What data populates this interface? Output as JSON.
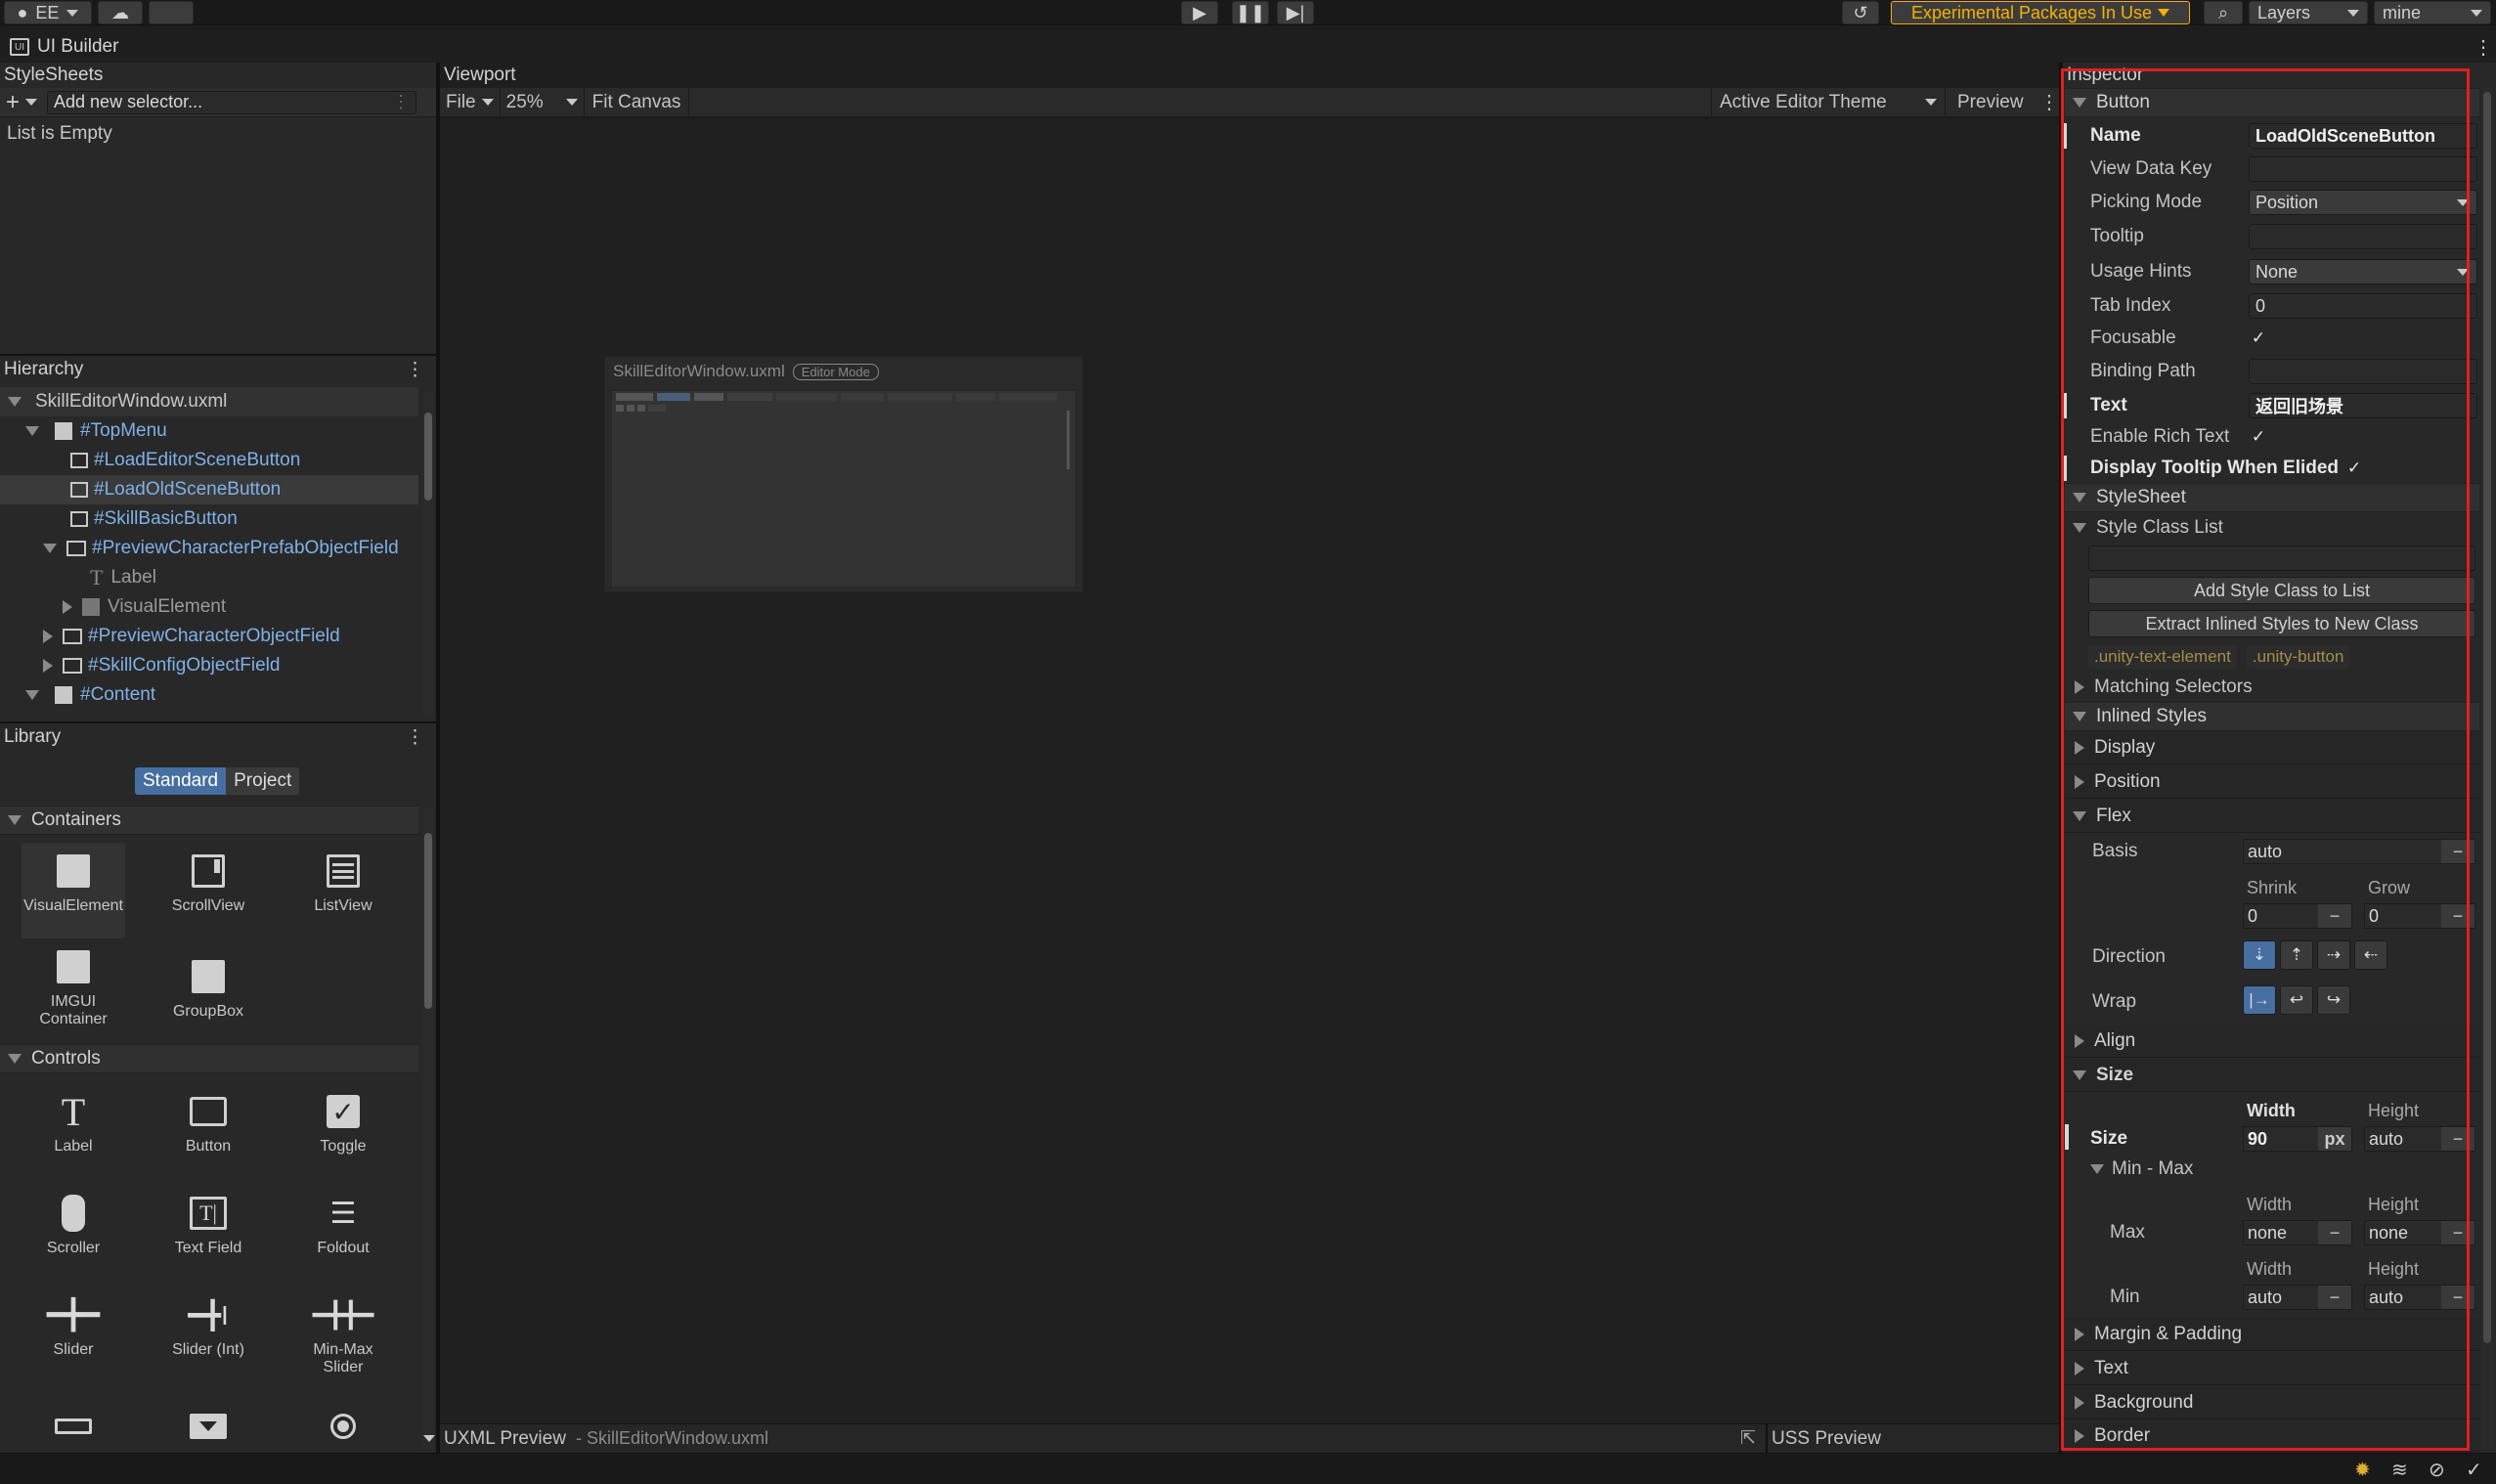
{
  "topbar": {
    "account_label": "EE",
    "packages_warning": "Experimental Packages In Use",
    "layers_label": "Layers",
    "layout_label": "mine",
    "warning_color": "#f6b200"
  },
  "window": {
    "title": "UI Builder"
  },
  "stylesheets": {
    "header": "StyleSheets",
    "add_label": "+",
    "selector_placeholder": "Add new selector...",
    "empty_text": "List is Empty"
  },
  "hierarchy": {
    "header": "Hierarchy",
    "items": [
      {
        "label": "SkillEditorWindow.uxml"
      },
      {
        "label": "#TopMenu"
      },
      {
        "label": "#LoadEditorSceneButton"
      },
      {
        "label": "#LoadOldSceneButton"
      },
      {
        "label": "#SkillBasicButton"
      },
      {
        "label": "#PreviewCharacterPrefabObjectField"
      },
      {
        "label": "Label"
      },
      {
        "label": "VisualElement"
      },
      {
        "label": "#PreviewCharacterObjectField"
      },
      {
        "label": "#SkillConfigObjectField"
      },
      {
        "label": "#Content"
      }
    ]
  },
  "library": {
    "header": "Library",
    "tabs": [
      "Standard",
      "Project"
    ],
    "containers_header": "Containers",
    "containers": [
      "VisualElement",
      "ScrollView",
      "ListView",
      "IMGUI Container",
      "GroupBox"
    ],
    "controls_header": "Controls",
    "controls": [
      "Label",
      "Button",
      "Toggle",
      "Scroller",
      "Text Field",
      "Foldout",
      "Slider",
      "Slider (Int)",
      "Min-Max Slider"
    ]
  },
  "viewport": {
    "header": "Viewport",
    "file_menu": "File",
    "zoom": "25%",
    "fit_canvas": "Fit Canvas",
    "theme": "Active Editor Theme",
    "preview": "Preview",
    "canvas_title": "SkillEditorWindow.uxml",
    "canvas_badge": "Editor Mode",
    "uxml_preview": "UXML Preview",
    "uxml_file": "- SkillEditorWindow.uxml",
    "uss_preview": "USS Preview"
  },
  "inspector": {
    "header": "Inspector",
    "button_section": "Button",
    "fields": {
      "name_label": "Name",
      "name_value": "LoadOldSceneButton",
      "view_data_key": "View Data Key",
      "picking_mode": "Picking Mode",
      "picking_mode_value": "Position",
      "tooltip": "Tooltip",
      "usage_hints": "Usage Hints",
      "usage_hints_value": "None",
      "tab_index": "Tab Index",
      "tab_index_value": "0",
      "focusable": "Focusable",
      "binding_path": "Binding Path",
      "text_label": "Text",
      "text_value": "返回旧场景",
      "enable_rich_text": "Enable Rich Text",
      "display_tooltip": "Display Tooltip When Elided"
    },
    "stylesheet_section": "StyleSheet",
    "style_class_list": "Style Class List",
    "add_style_class": "Add Style Class to List",
    "extract_inlined": "Extract Inlined Styles to New Class",
    "classes": [
      ".unity-text-element",
      ".unity-button"
    ],
    "matching_selectors": "Matching Selectors",
    "inlined_styles": "Inlined Styles",
    "display": "Display",
    "position": "Position",
    "flex": "Flex",
    "basis_label": "Basis",
    "basis_value": "auto",
    "shrink_label": "Shrink",
    "shrink_value": "0",
    "grow_label": "Grow",
    "grow_value": "0",
    "direction_label": "Direction",
    "wrap_label": "Wrap",
    "align": "Align",
    "size": "Size",
    "width_label": "Width",
    "height_label": "Height",
    "size_label": "Size",
    "size_width": "90",
    "size_unit": "px",
    "size_height": "auto",
    "min_max": "Min - Max",
    "max_label": "Max",
    "max_width": "none",
    "max_height": "none",
    "min_label": "Min",
    "min_width": "auto",
    "min_height": "auto",
    "margin_padding": "Margin & Padding",
    "text_section": "Text",
    "background": "Background",
    "border": "Border",
    "highlight_color": "#e02020"
  }
}
